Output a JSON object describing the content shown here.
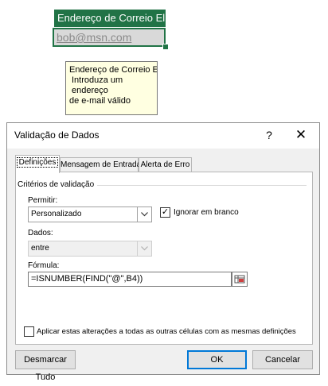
{
  "spreadsheet": {
    "header_text": "Endereço de Correio El",
    "cell_value": "bob@msn.com"
  },
  "input_tooltip": {
    "title": "Endereço de Correio Eletrónico",
    "line1": "Introduza um endereço",
    "line2": "de e-mail válido"
  },
  "dialog": {
    "title": "Validação de Dados",
    "help_glyph": "?",
    "close_glyph": "✕",
    "tabs": [
      {
        "label": "Definições",
        "active": true
      },
      {
        "label": "Mensagem de Entrada",
        "active": false
      },
      {
        "label": "Alerta de Erro",
        "active": false
      }
    ],
    "criteria_label": "Critérios de validação",
    "allow": {
      "label": "Permitir:",
      "value": "Personalizado"
    },
    "ignore_blank": {
      "label": "Ignorar em branco",
      "checked": true,
      "mark": "✓"
    },
    "data": {
      "label": "Dados:",
      "value": "entre"
    },
    "formula": {
      "label": "Fórmula:",
      "value": "=ISNUMBER(FIND(\"@\",B4))"
    },
    "apply_all": {
      "label": "Aplicar estas alterações a todas as outras células com as mesmas definições",
      "checked": false
    },
    "buttons": {
      "clear_all": "Desmarcar Tudo",
      "ok": "OK",
      "cancel": "Cancelar"
    },
    "icons": {
      "dropdown": "chevron-down-icon",
      "range": "range-selector-icon"
    }
  }
}
